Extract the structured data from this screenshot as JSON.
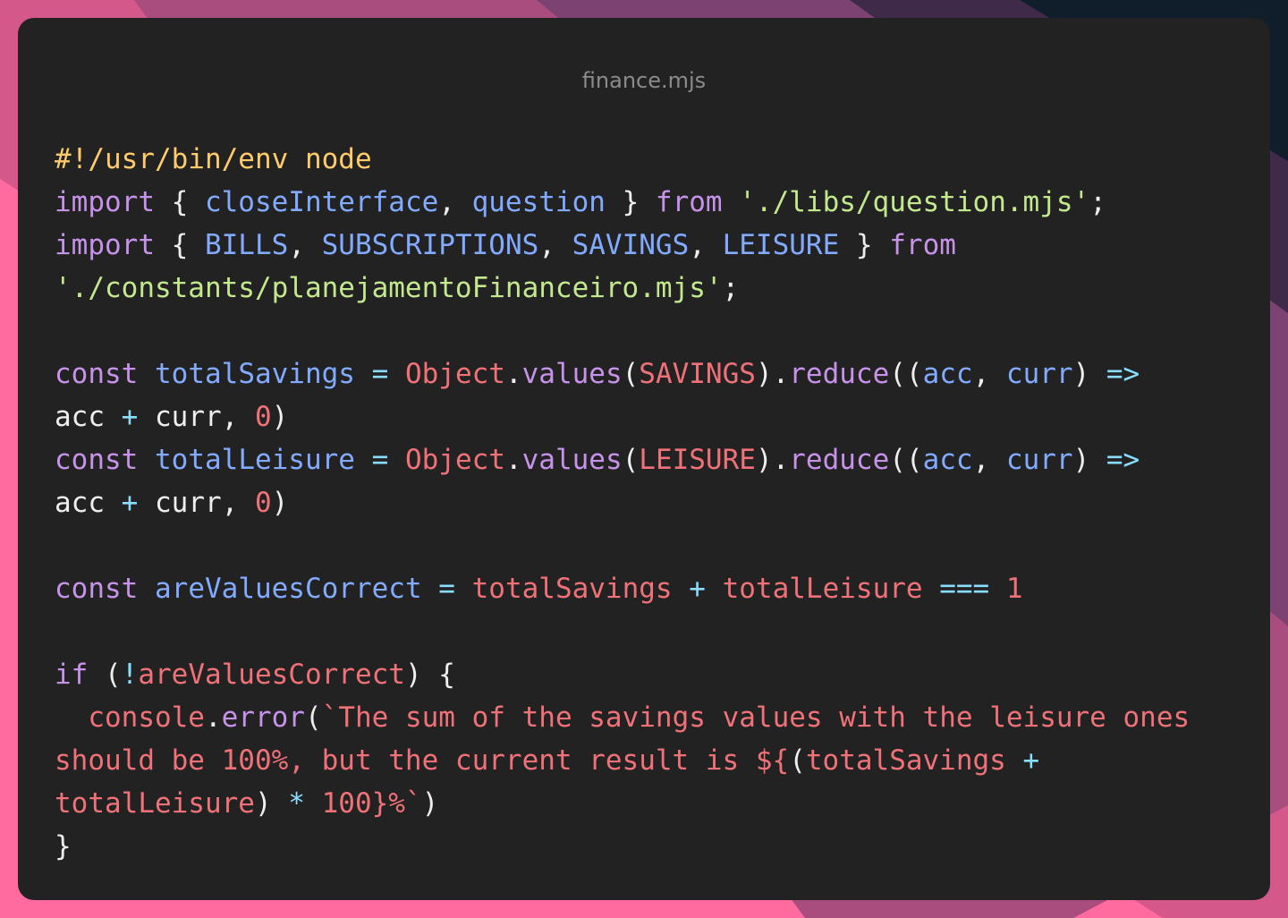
{
  "window": {
    "title": "finance.mjs"
  },
  "theme": {
    "background": "#222222",
    "keyword": "#c792ea",
    "identifier": "#82aaff",
    "string": "#c3e88d",
    "shebang": "#ffcb6b",
    "number": "#f07178",
    "operator": "#89ddff",
    "plain": "#eeeeee",
    "method": "#c792ea",
    "object": "#f07178",
    "template": "#f07178"
  },
  "code": {
    "lines": [
      [
        {
          "t": "#!/usr/bin/env node",
          "c": "shebang"
        }
      ],
      [
        {
          "t": "import",
          "c": "keyword"
        },
        {
          "t": " { ",
          "c": "plain"
        },
        {
          "t": "closeInterface",
          "c": "identifier"
        },
        {
          "t": ", ",
          "c": "plain"
        },
        {
          "t": "question",
          "c": "identifier"
        },
        {
          "t": " } ",
          "c": "plain"
        },
        {
          "t": "from",
          "c": "keyword"
        },
        {
          "t": " ",
          "c": "plain"
        },
        {
          "t": "'./libs/question.mjs'",
          "c": "string"
        },
        {
          "t": ";",
          "c": "plain"
        }
      ],
      [
        {
          "t": "import",
          "c": "keyword"
        },
        {
          "t": " { ",
          "c": "plain"
        },
        {
          "t": "BILLS",
          "c": "identifier"
        },
        {
          "t": ", ",
          "c": "plain"
        },
        {
          "t": "SUBSCRIPTIONS",
          "c": "identifier"
        },
        {
          "t": ", ",
          "c": "plain"
        },
        {
          "t": "SAVINGS",
          "c": "identifier"
        },
        {
          "t": ", ",
          "c": "plain"
        },
        {
          "t": "LEISURE",
          "c": "identifier"
        },
        {
          "t": " } ",
          "c": "plain"
        },
        {
          "t": "from",
          "c": "keyword"
        }
      ],
      [
        {
          "t": "'./constants/planejamentoFinanceiro.mjs'",
          "c": "string"
        },
        {
          "t": ";",
          "c": "plain"
        }
      ],
      [],
      [
        {
          "t": "const",
          "c": "keyword"
        },
        {
          "t": " ",
          "c": "plain"
        },
        {
          "t": "totalSavings",
          "c": "identifier"
        },
        {
          "t": " = ",
          "c": "operator"
        },
        {
          "t": "Object",
          "c": "object"
        },
        {
          "t": ".",
          "c": "plain"
        },
        {
          "t": "values",
          "c": "method"
        },
        {
          "t": "(",
          "c": "plain"
        },
        {
          "t": "SAVINGS",
          "c": "object"
        },
        {
          "t": ").",
          "c": "plain"
        },
        {
          "t": "reduce",
          "c": "method"
        },
        {
          "t": "((",
          "c": "plain"
        },
        {
          "t": "acc",
          "c": "identifier"
        },
        {
          "t": ", ",
          "c": "plain"
        },
        {
          "t": "curr",
          "c": "identifier"
        },
        {
          "t": ") ",
          "c": "plain"
        },
        {
          "t": "=>",
          "c": "operator"
        }
      ],
      [
        {
          "t": "acc",
          "c": "plain"
        },
        {
          "t": " + ",
          "c": "operator"
        },
        {
          "t": "curr",
          "c": "plain"
        },
        {
          "t": ", ",
          "c": "plain"
        },
        {
          "t": "0",
          "c": "number"
        },
        {
          "t": ")",
          "c": "plain"
        }
      ],
      [
        {
          "t": "const",
          "c": "keyword"
        },
        {
          "t": " ",
          "c": "plain"
        },
        {
          "t": "totalLeisure",
          "c": "identifier"
        },
        {
          "t": " = ",
          "c": "operator"
        },
        {
          "t": "Object",
          "c": "object"
        },
        {
          "t": ".",
          "c": "plain"
        },
        {
          "t": "values",
          "c": "method"
        },
        {
          "t": "(",
          "c": "plain"
        },
        {
          "t": "LEISURE",
          "c": "object"
        },
        {
          "t": ").",
          "c": "plain"
        },
        {
          "t": "reduce",
          "c": "method"
        },
        {
          "t": "((",
          "c": "plain"
        },
        {
          "t": "acc",
          "c": "identifier"
        },
        {
          "t": ", ",
          "c": "plain"
        },
        {
          "t": "curr",
          "c": "identifier"
        },
        {
          "t": ") ",
          "c": "plain"
        },
        {
          "t": "=>",
          "c": "operator"
        }
      ],
      [
        {
          "t": "acc",
          "c": "plain"
        },
        {
          "t": " + ",
          "c": "operator"
        },
        {
          "t": "curr",
          "c": "plain"
        },
        {
          "t": ", ",
          "c": "plain"
        },
        {
          "t": "0",
          "c": "number"
        },
        {
          "t": ")",
          "c": "plain"
        }
      ],
      [],
      [
        {
          "t": "const",
          "c": "keyword"
        },
        {
          "t": " ",
          "c": "plain"
        },
        {
          "t": "areValuesCorrect",
          "c": "identifier"
        },
        {
          "t": " = ",
          "c": "operator"
        },
        {
          "t": "totalSavings",
          "c": "object"
        },
        {
          "t": " + ",
          "c": "operator"
        },
        {
          "t": "totalLeisure",
          "c": "object"
        },
        {
          "t": " === ",
          "c": "operator"
        },
        {
          "t": "1",
          "c": "number"
        }
      ],
      [],
      [
        {
          "t": "if",
          "c": "keyword"
        },
        {
          "t": " (",
          "c": "plain"
        },
        {
          "t": "!",
          "c": "operator"
        },
        {
          "t": "areValuesCorrect",
          "c": "object"
        },
        {
          "t": ") {",
          "c": "plain"
        }
      ],
      [
        {
          "t": "  ",
          "c": "plain"
        },
        {
          "t": "console",
          "c": "object"
        },
        {
          "t": ".",
          "c": "plain"
        },
        {
          "t": "error",
          "c": "method"
        },
        {
          "t": "(",
          "c": "plain"
        },
        {
          "t": "`The sum of the savings values with the leisure ones",
          "c": "template"
        }
      ],
      [
        {
          "t": "should be 100%, but the current result is ${",
          "c": "template"
        },
        {
          "t": "(",
          "c": "plain"
        },
        {
          "t": "totalSavings",
          "c": "object"
        },
        {
          "t": " + ",
          "c": "operator"
        }
      ],
      [
        {
          "t": "totalLeisure",
          "c": "object"
        },
        {
          "t": ") ",
          "c": "plain"
        },
        {
          "t": "*",
          "c": "operator"
        },
        {
          "t": " ",
          "c": "plain"
        },
        {
          "t": "100",
          "c": "number"
        },
        {
          "t": "}%`",
          "c": "template"
        },
        {
          "t": ")",
          "c": "plain"
        }
      ],
      [
        {
          "t": "}",
          "c": "plain"
        }
      ]
    ]
  }
}
